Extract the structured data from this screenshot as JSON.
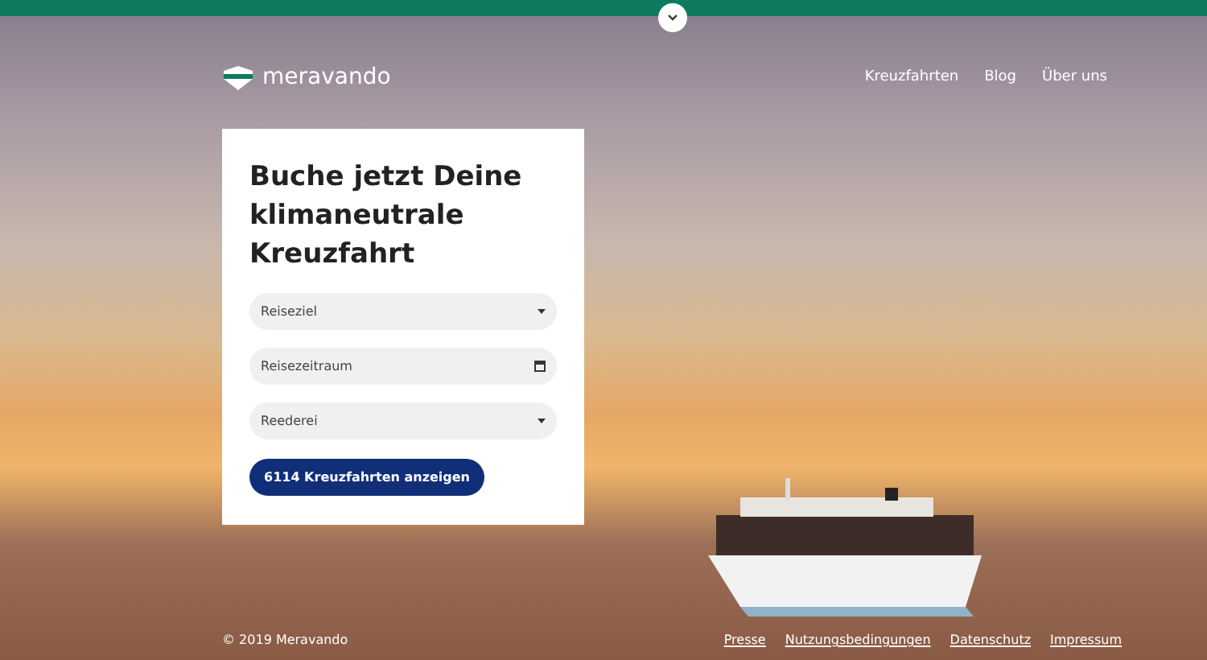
{
  "header": {
    "logo": "meravando",
    "nav": [
      {
        "label": "Kreuzfahrten"
      },
      {
        "label": "Blog"
      },
      {
        "label": "Über uns"
      }
    ]
  },
  "card": {
    "title": "Buche jetzt Deine klimaneutrale Kreuzfahrt",
    "fields": [
      {
        "kind": "select",
        "placeholder": "Reiseziel"
      },
      {
        "kind": "date",
        "placeholder": "Reisezeitraum"
      },
      {
        "kind": "select",
        "placeholder": "Reederei"
      }
    ],
    "button": "6114 Kreuzfahrten anzeigen"
  },
  "footer": {
    "copyright": "© 2019 Meravando",
    "links": [
      {
        "label": "Presse"
      },
      {
        "label": "Nutzungsbedingungen"
      },
      {
        "label": "Datenschutz"
      },
      {
        "label": "Impressum"
      }
    ]
  }
}
